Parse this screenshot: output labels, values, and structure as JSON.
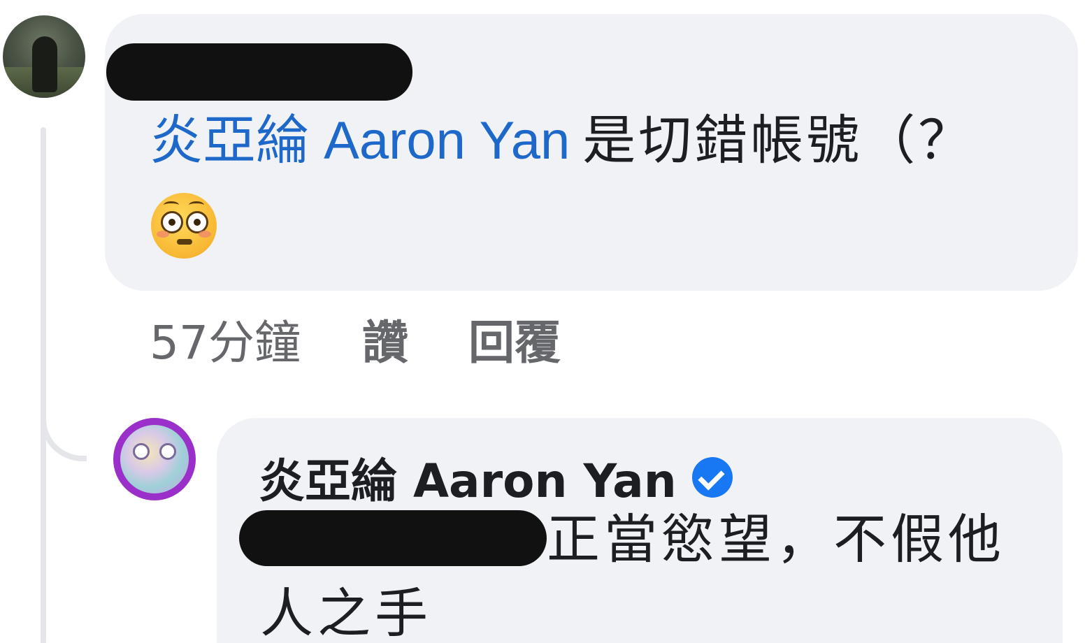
{
  "comment": {
    "mention_cjk": "炎亞綸",
    "mention_latin": "Aaron Yan",
    "text": "是切錯帳號（？",
    "emoji_name": "flushed-face-emoji"
  },
  "meta": {
    "time": "57分鐘",
    "like_label": "讚",
    "reply_label": "回覆"
  },
  "reply": {
    "author": "炎亞綸 Aaron Yan",
    "verified_icon": "verified-check-icon",
    "line1": "正當慾望，不假他",
    "line2": "人之手"
  },
  "colors": {
    "mention": "#1d68c9",
    "bubble": "#f0f2f5",
    "meta_text": "#65676b",
    "verified": "#1877f2",
    "avatar_ring": "#9a2fc9"
  }
}
